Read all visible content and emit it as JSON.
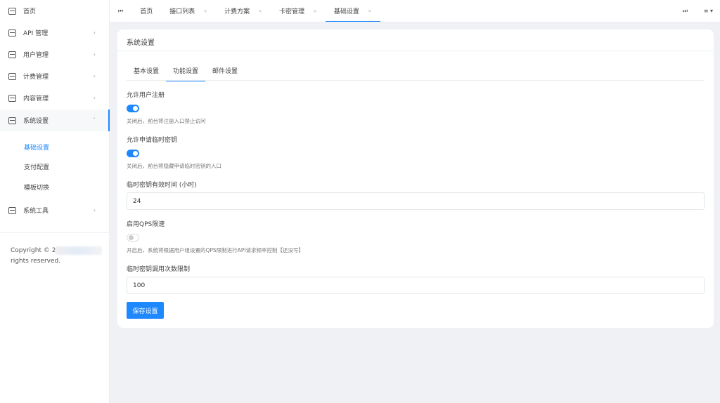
{
  "sidebar": {
    "items": [
      {
        "label": "首页",
        "icon": "home-icon"
      },
      {
        "label": "API 管理",
        "icon": "calendar-icon"
      },
      {
        "label": "用户管理",
        "icon": "calendar-icon"
      },
      {
        "label": "计费管理",
        "icon": "calendar-icon"
      },
      {
        "label": "内容管理",
        "icon": "calendar-icon"
      },
      {
        "label": "系统设置",
        "icon": "calendar-icon"
      },
      {
        "label": "系统工具",
        "icon": "calendar-icon"
      }
    ],
    "sub_items": [
      "基础设置",
      "支付配置",
      "模板切换"
    ],
    "copyright_prefix": "Copyright © 2",
    "copyright_suffix": "rights reserved."
  },
  "tabbar": {
    "tabs": [
      "首页",
      "接口列表",
      "计费方案",
      "卡密管理",
      "基础设置"
    ],
    "close": "×",
    "prev": "⏮",
    "next": "⏭",
    "menu": "≡ ▾"
  },
  "card": {
    "title": "系统设置",
    "tabs": [
      "基本设置",
      "功能设置",
      "邮件设置"
    ],
    "fields": {
      "reg_label": "允许用户注册",
      "reg_enabled": true,
      "reg_hint": "关闭后，前台将注册入口禁止访问",
      "tmp_label": "允许申请临时密钥",
      "tmp_enabled": true,
      "tmp_hint": "关闭后，前台将隐藏申请临时密钥的入口",
      "valid_label": "临时密钥有效时间 (小时)",
      "valid_value": "24",
      "qps_label": "启用QPS限速",
      "qps_enabled": false,
      "qps_hint": "开启后，系统将根据用户组设置的QPS限制进行API请求频率控制【还没写】",
      "limit_label": "临时密钥调用次数限制",
      "limit_value": "100"
    },
    "save": "保存设置"
  },
  "colors": {
    "accent": "#1e88ff"
  }
}
